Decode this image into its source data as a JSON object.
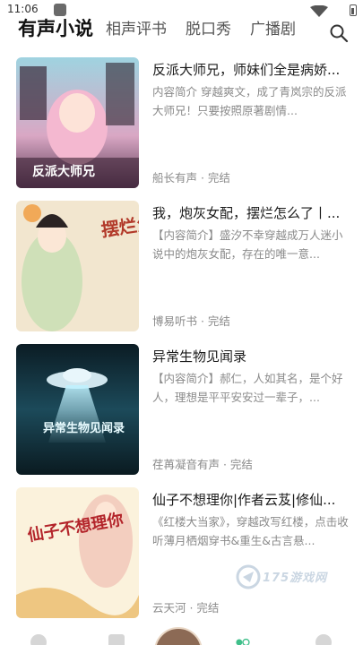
{
  "status": {
    "time": "11:06"
  },
  "tabs": [
    {
      "label": "有声小说",
      "active": true
    },
    {
      "label": "相声评书",
      "active": false
    },
    {
      "label": "脱口秀",
      "active": false
    },
    {
      "label": "广播剧",
      "active": false
    }
  ],
  "icons": {
    "search": "search-icon",
    "wifi": "wifi-icon",
    "battery": "battery-icon"
  },
  "items": [
    {
      "title": "反派大师兄，师妹们全是病娇...",
      "desc": "内容简介 穿越爽文，成了青岚宗的反派大师兄！只要按照原著剧情...",
      "meta": "船长有声 · 完结",
      "cover_text": "反派大师兄"
    },
    {
      "title": "我，炮灰女配，摆烂怎么了丨...",
      "desc": "【内容简介】盛汐不幸穿越成万人迷小说中的炮灰女配，存在的唯一意...",
      "meta": "博易听书 · 完结",
      "cover_text": "摆烂怎么了 炮灰女配"
    },
    {
      "title": "异常生物见闻录",
      "desc": "【内容简介】郝仁，人如其名，是个好人，理想是平平安安过一辈子，...",
      "meta": "荏苒凝音有声 · 完结",
      "cover_text": "异常生物见闻录"
    },
    {
      "title": "仙子不想理你|作者云芨|修仙...",
      "desc": "《红楼大当家》，穿越改写红楼，点击收听薄月栖烟穿书&重生&古言悬...",
      "meta": "云天河 · 完结",
      "cover_text": "仙子不想理你"
    }
  ],
  "watermark": "175游戏网",
  "colors": {
    "active_tab": "#111111",
    "inactive_tab": "#555555",
    "meta": "#8a8a8a",
    "nav_active": "#3fbf8a"
  }
}
